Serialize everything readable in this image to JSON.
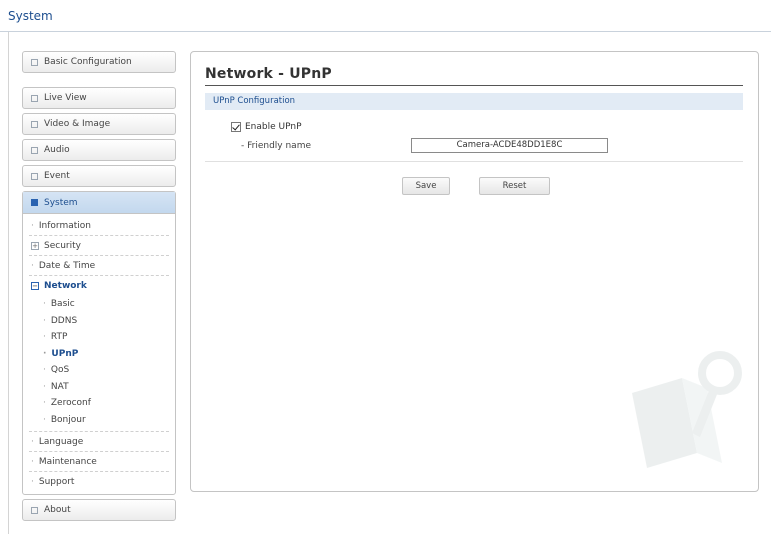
{
  "header": {
    "title": "System"
  },
  "sidebar": {
    "top_items": [
      {
        "label": "Basic Configuration"
      },
      {
        "label": "Live View"
      },
      {
        "label": "Video & Image"
      },
      {
        "label": "Audio"
      },
      {
        "label": "Event"
      }
    ],
    "system": {
      "label": "System",
      "items": [
        {
          "label": "Information"
        },
        {
          "label": "Security"
        },
        {
          "label": "Date & Time"
        },
        {
          "label": "Network"
        },
        {
          "label": "Language"
        },
        {
          "label": "Maintenance"
        },
        {
          "label": "Support"
        }
      ],
      "network_items": [
        {
          "label": "Basic"
        },
        {
          "label": "DDNS"
        },
        {
          "label": "RTP"
        },
        {
          "label": "UPnP"
        },
        {
          "label": "QoS"
        },
        {
          "label": "NAT"
        },
        {
          "label": "Zeroconf"
        },
        {
          "label": "Bonjour"
        }
      ]
    },
    "about": {
      "label": "About"
    }
  },
  "main": {
    "title": "Network - UPnP",
    "section": "UPnP Configuration",
    "enable_label": "Enable UPnP",
    "enable_checked": true,
    "friendly_name_label": "- Friendly name",
    "friendly_name_value": "Camera-ACDE48DD1E8C",
    "save_label": "Save",
    "reset_label": "Reset"
  },
  "colors": {
    "accent": "#1d4e8f",
    "section_bar": "#e2ebf5",
    "active_nav": "#c3d8ee"
  }
}
